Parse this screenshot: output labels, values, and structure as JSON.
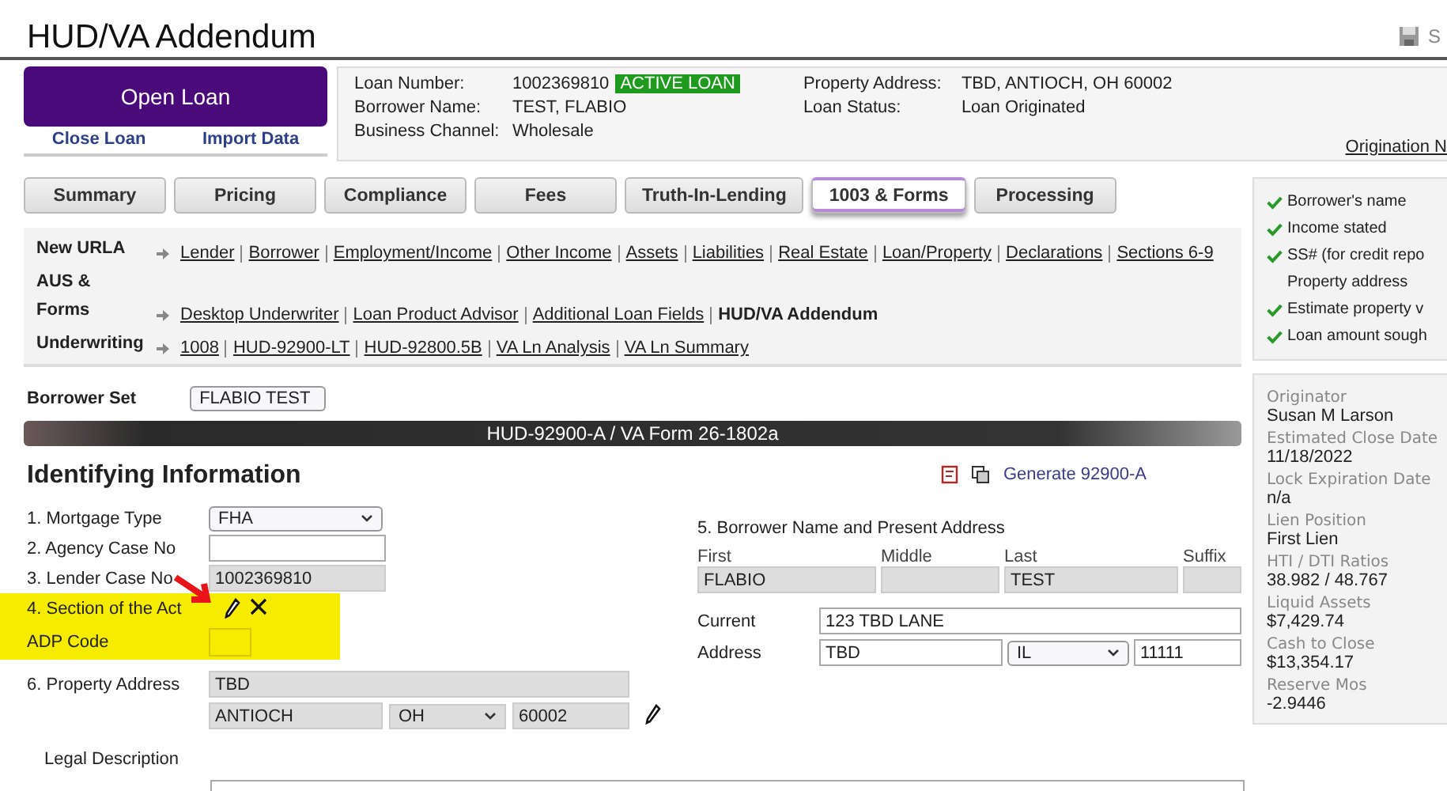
{
  "page_title": "HUD/VA Addendum",
  "save_label": "S",
  "header": {
    "open_button": "Open Loan",
    "links": [
      "Close Loan",
      "Import Data"
    ],
    "fields": [
      {
        "label": "Loan Number:",
        "value": "1002369810",
        "badge": "ACTIVE LOAN"
      },
      {
        "label": "Borrower Name:",
        "value": "TEST, FLABIO"
      },
      {
        "label": "Business Channel:",
        "value": "Wholesale"
      }
    ],
    "fields_right": [
      {
        "label": "Property Address:",
        "value": "TBD, ANTIOCH, OH 60002"
      },
      {
        "label": "Loan Status:",
        "value": "Loan Originated"
      }
    ],
    "origination_link": "Origination N"
  },
  "tabs": [
    {
      "label": "Summary",
      "selected": false
    },
    {
      "label": "Pricing",
      "selected": false
    },
    {
      "label": "Compliance",
      "selected": false
    },
    {
      "label": "Fees",
      "selected": false
    },
    {
      "label": "Truth-In-Lending",
      "selected": false
    },
    {
      "label": "1003 & Forms",
      "selected": true
    },
    {
      "label": "Processing",
      "selected": false
    }
  ],
  "nav": [
    {
      "group": "New URLA",
      "links": [
        {
          "text": "Lender",
          "selected": false
        },
        {
          "text": "Borrower",
          "selected": false
        },
        {
          "text": "Employment/Income",
          "selected": false
        },
        {
          "text": "Other Income",
          "selected": false
        },
        {
          "text": "Assets",
          "selected": false
        },
        {
          "text": "Liabilities",
          "selected": false
        },
        {
          "text": "Real Estate",
          "selected": false
        },
        {
          "text": "Loan/Property",
          "selected": false
        },
        {
          "text": "Declarations",
          "selected": false
        },
        {
          "text": "Sections 6-9",
          "selected": false
        }
      ]
    },
    {
      "group": "AUS & Forms",
      "links": [
        {
          "text": "Desktop Underwriter",
          "selected": false
        },
        {
          "text": "Loan Product Advisor",
          "selected": false
        },
        {
          "text": "Additional Loan Fields",
          "selected": false
        },
        {
          "text": "HUD/VA Addendum",
          "selected": true
        }
      ]
    },
    {
      "group": "Underwriting",
      "links": [
        {
          "text": "1008",
          "selected": false
        },
        {
          "text": "HUD-92900-LT",
          "selected": false
        },
        {
          "text": "HUD-92800.5B",
          "selected": false
        },
        {
          "text": "VA Ln Analysis",
          "selected": false
        },
        {
          "text": "VA Ln Summary",
          "selected": false
        }
      ]
    }
  ],
  "borrower_set": {
    "label": "Borrower Set",
    "value": "FLABIO TEST"
  },
  "form": {
    "banner": "HUD-92900-A / VA Form 26-1802a",
    "heading": "Identifying Information",
    "generate_link": "Generate 92900-A",
    "mortgage_type": {
      "label": "1. Mortgage Type",
      "value": "FHA"
    },
    "agency_case_no": {
      "label": "2. Agency Case No"
    },
    "lender_case_no": {
      "label": "3. Lender Case No",
      "value": "1002369810"
    },
    "section_of_act": {
      "label": "4. Section of the Act"
    },
    "adp_code": {
      "label": "ADP Code"
    },
    "property_address": {
      "label": "6. Property Address",
      "street": "TBD",
      "city": "ANTIOCH",
      "state": "OH",
      "zip": "60002"
    },
    "legal_description": {
      "label": "Legal Description"
    },
    "borrower": {
      "heading": "5. Borrower Name and Present Address",
      "name_fields": [
        {
          "label": "First",
          "value": "FLABIO"
        },
        {
          "label": "Middle"
        },
        {
          "label": "Last",
          "value": "TEST"
        },
        {
          "label": "Suffix"
        }
      ],
      "current_label": "Current",
      "address_label": "Address",
      "street": "123 TBD LANE",
      "city": "TBD",
      "state": "IL",
      "zip": "11111"
    }
  },
  "checklist": [
    {
      "text": "Borrower's name",
      "checked": true
    },
    {
      "text": "Income stated",
      "checked": true
    },
    {
      "text": "SS# (for credit repo",
      "checked": true
    },
    {
      "text": "Property address",
      "checked": false
    },
    {
      "text": "Estimate property v",
      "checked": true
    },
    {
      "text": "Loan amount sough",
      "checked": true
    }
  ],
  "summary": [
    {
      "label": "Originator",
      "value": "Susan M Larson"
    },
    {
      "label": "Estimated Close Date",
      "value": "11/18/2022"
    },
    {
      "label": "Lock Expiration Date",
      "value": "n/a"
    },
    {
      "label": "Lien Position",
      "value": "First Lien"
    },
    {
      "label": "HTI / DTI Ratios",
      "value": "38.982 / 48.767"
    },
    {
      "label": "Liquid Assets",
      "value": "$7,429.74"
    },
    {
      "label": "Cash to Close",
      "value": "$13,354.17"
    },
    {
      "label": "Reserve Mos",
      "value": "-2.9446"
    }
  ]
}
